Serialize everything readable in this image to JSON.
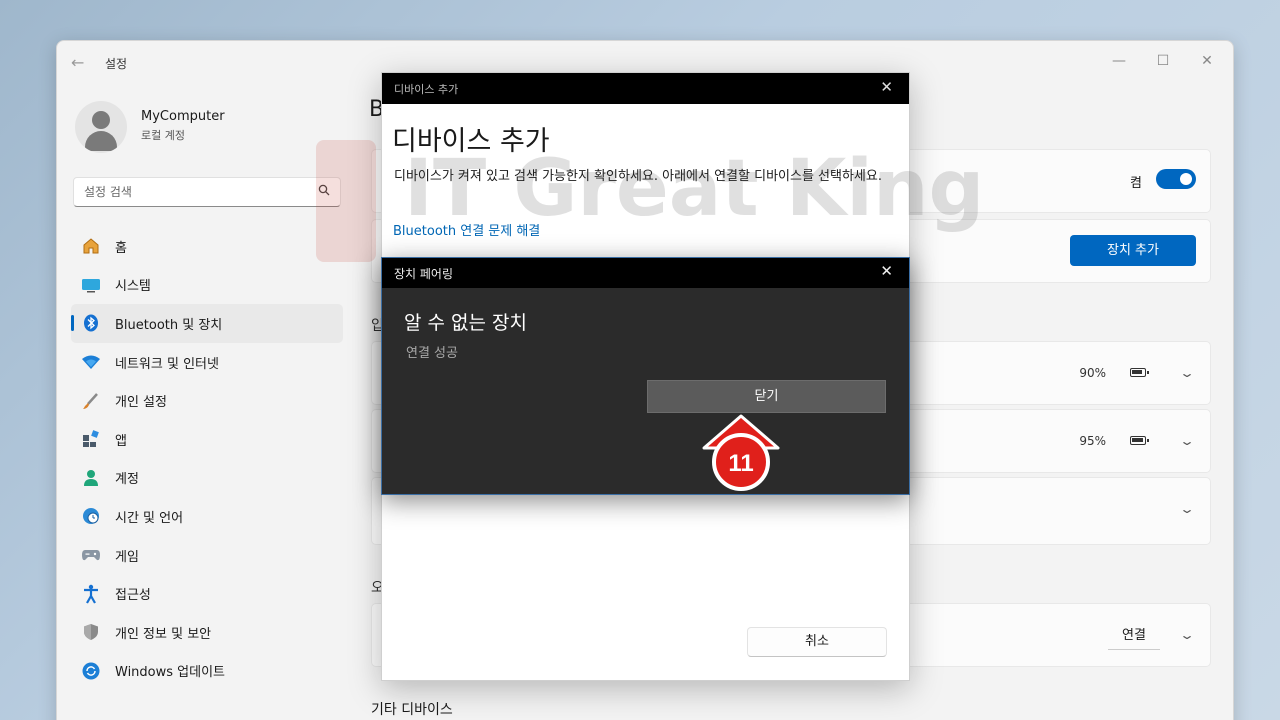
{
  "window": {
    "title": "설정",
    "back_icon": "back-arrow-icon",
    "controls": {
      "minimize": "—",
      "maximize": "☐",
      "close": "✕"
    }
  },
  "profile": {
    "name": "MyComputer",
    "subtitle": "로컬 계정",
    "avatar_icon": "user-avatar-icon"
  },
  "search": {
    "placeholder": "설정 검색",
    "icon": "search-icon"
  },
  "nav": {
    "items": [
      {
        "label": "홈",
        "icon": "home-icon"
      },
      {
        "label": "시스템",
        "icon": "display-icon"
      },
      {
        "label": "Bluetooth 및 장치",
        "icon": "bluetooth-icon",
        "active": true
      },
      {
        "label": "네트워크 및 인터넷",
        "icon": "wifi-icon"
      },
      {
        "label": "개인 설정",
        "icon": "brush-icon"
      },
      {
        "label": "앱",
        "icon": "apps-icon"
      },
      {
        "label": "계정",
        "icon": "account-icon"
      },
      {
        "label": "시간 및 언어",
        "icon": "globe-clock-icon"
      },
      {
        "label": "게임",
        "icon": "gamepad-icon"
      },
      {
        "label": "접근성",
        "icon": "accessibility-icon"
      },
      {
        "label": "개인 정보 및 보안",
        "icon": "shield-icon"
      },
      {
        "label": "Windows 업데이트",
        "icon": "update-icon"
      }
    ]
  },
  "main": {
    "heading_fragment": "B",
    "bluetooth_toggle": {
      "label": "켬",
      "on": true
    },
    "add_device_button": "장치 추가",
    "section_fragment_1": "입",
    "section_fragment_2": "오",
    "devices": [
      {
        "battery": "90%",
        "battery_level": 0.9
      },
      {
        "battery": "95%",
        "battery_level": 0.95
      },
      {}
    ],
    "connect_button": "연결",
    "other_devices_title": "기타 디바이스"
  },
  "add_dialog": {
    "titlebar": "디바이스 추가",
    "heading": "디바이스 추가",
    "description": "디바이스가 켜져 있고 검색 가능한지 확인하세요. 아래에서 연결할 디바이스를 선택하세요.",
    "link": "Bluetooth 연결 문제 해결",
    "cancel_button": "취소"
  },
  "pairing_dialog": {
    "titlebar": "장치 페어링",
    "heading": "알 수 없는 장치",
    "status": "연결 성공",
    "close_button": "닫기"
  },
  "watermark": {
    "text": "IT Great King"
  },
  "step_marker": {
    "number": "11"
  },
  "colors": {
    "accent": "#0067c0",
    "link": "#0066b4",
    "marker_red": "#e0201b",
    "dark_dialog": "#2b2b2b"
  }
}
